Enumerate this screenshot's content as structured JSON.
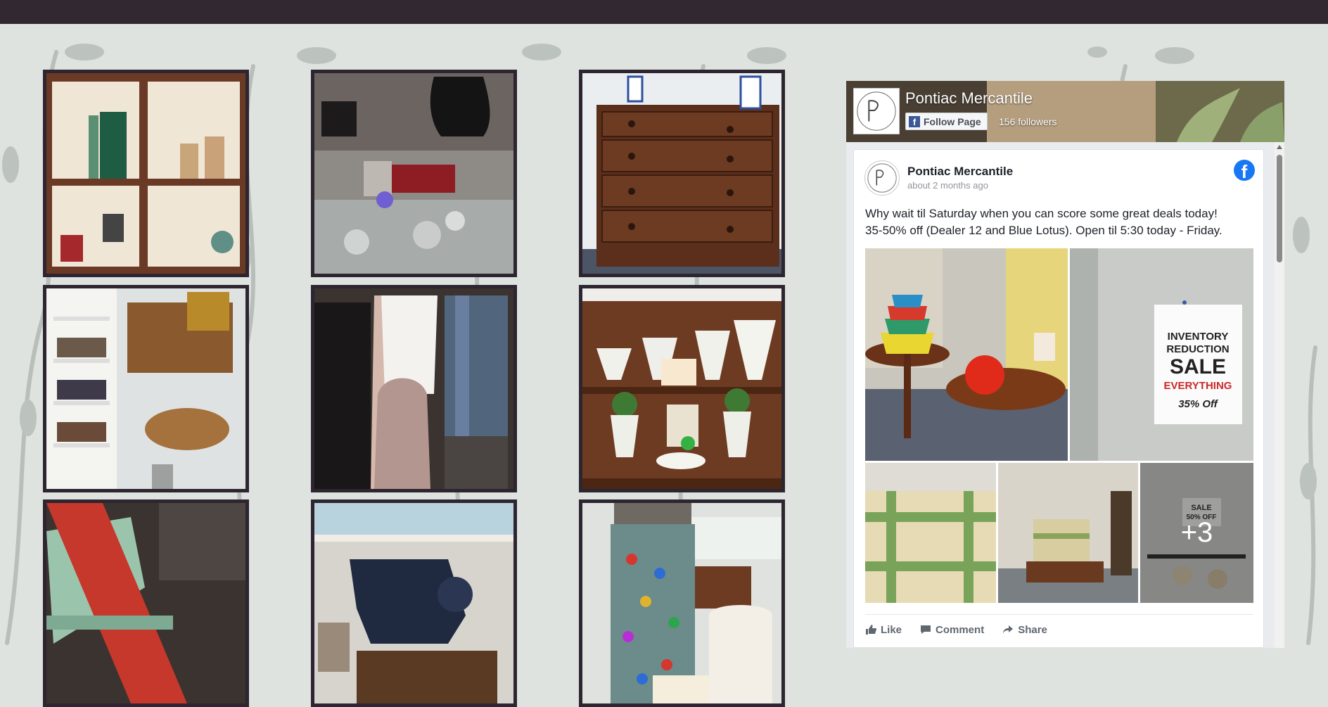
{
  "colors": {
    "topbar": "#312832",
    "background": "#dfe3e0",
    "pattern": "#b8beba",
    "tile_frame": "#2d2530",
    "facebook_blue": "#1877f2"
  },
  "gallery": {
    "tiles": [
      {
        "name": "shelving-cubes-photo"
      },
      {
        "name": "jewelry-display-photo"
      },
      {
        "name": "wooden-dresser-photo"
      },
      {
        "name": "bookshelf-corner-photo"
      },
      {
        "name": "clothing-rack-photo"
      },
      {
        "name": "milk-glass-shelf-photo"
      },
      {
        "name": "pennant-chair-photo"
      },
      {
        "name": "sewing-machine-photo"
      },
      {
        "name": "marble-jar-photo"
      }
    ]
  },
  "facebook": {
    "page_name": "Pontiac Mercantile",
    "follow_label": "Follow Page",
    "followers": "156 followers",
    "post": {
      "author": "Pontiac Mercantile",
      "time": "about 2 months ago",
      "text_line1": "Why wait til Saturday when you can score some great deals today!",
      "text_line2": "35-50% off (Dealer 12 and Blue Lotus). Open til 5:30 today - Friday.",
      "more_photos": "+3",
      "sign_text": {
        "line1": "INVENTORY",
        "line2": "REDUCTION",
        "line3": "SALE",
        "line4": "EVERYTHING",
        "line5": "35% Off"
      },
      "small_sign": {
        "line1": "SALE",
        "line2": "50% OFF"
      },
      "actions": {
        "like": "Like",
        "comment": "Comment",
        "share": "Share"
      }
    }
  }
}
